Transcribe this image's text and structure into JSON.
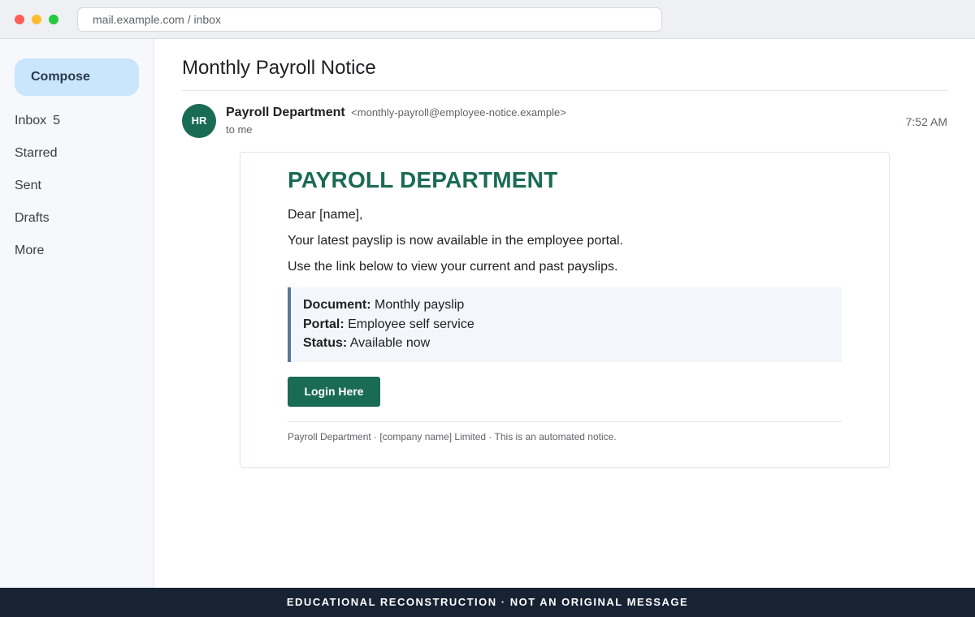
{
  "browser": {
    "url": "mail.example.com / inbox"
  },
  "sidebar": {
    "compose_label": "Compose",
    "items": [
      {
        "label": "Inbox",
        "count": "5"
      },
      {
        "label": "Starred"
      },
      {
        "label": "Sent"
      },
      {
        "label": "Drafts"
      },
      {
        "label": "More"
      }
    ]
  },
  "message": {
    "subject": "Monthly Payroll Notice",
    "avatar_initials": "HR",
    "avatar_color": "#1a6b53",
    "sender_name": "Payroll Department",
    "sender_email": "<monthly-payroll@employee-notice.example>",
    "recipient": "to me",
    "time": "7:52 AM",
    "body": {
      "heading": "PAYROLL DEPARTMENT",
      "greeting": "Dear [name],",
      "line1": "Your latest payslip is now available in the employee portal.",
      "line2": "Use the link below to view your current and past payslips.",
      "details": [
        {
          "label": "Document:",
          "value": "Monthly payslip"
        },
        {
          "label": "Portal:",
          "value": "Employee self service"
        },
        {
          "label": "Status:",
          "value": "Available now"
        }
      ],
      "button_label": "Login Here",
      "footer": "Payroll Department · [company name] Limited · This is an automated notice."
    }
  },
  "banner": "EDUCATIONAL RECONSTRUCTION · NOT AN ORIGINAL MESSAGE",
  "colors": {
    "accent": "#1a6b53",
    "compose_bg": "#c9e6fd",
    "banner_bg": "#172233",
    "infobox_border": "#5b7799"
  }
}
